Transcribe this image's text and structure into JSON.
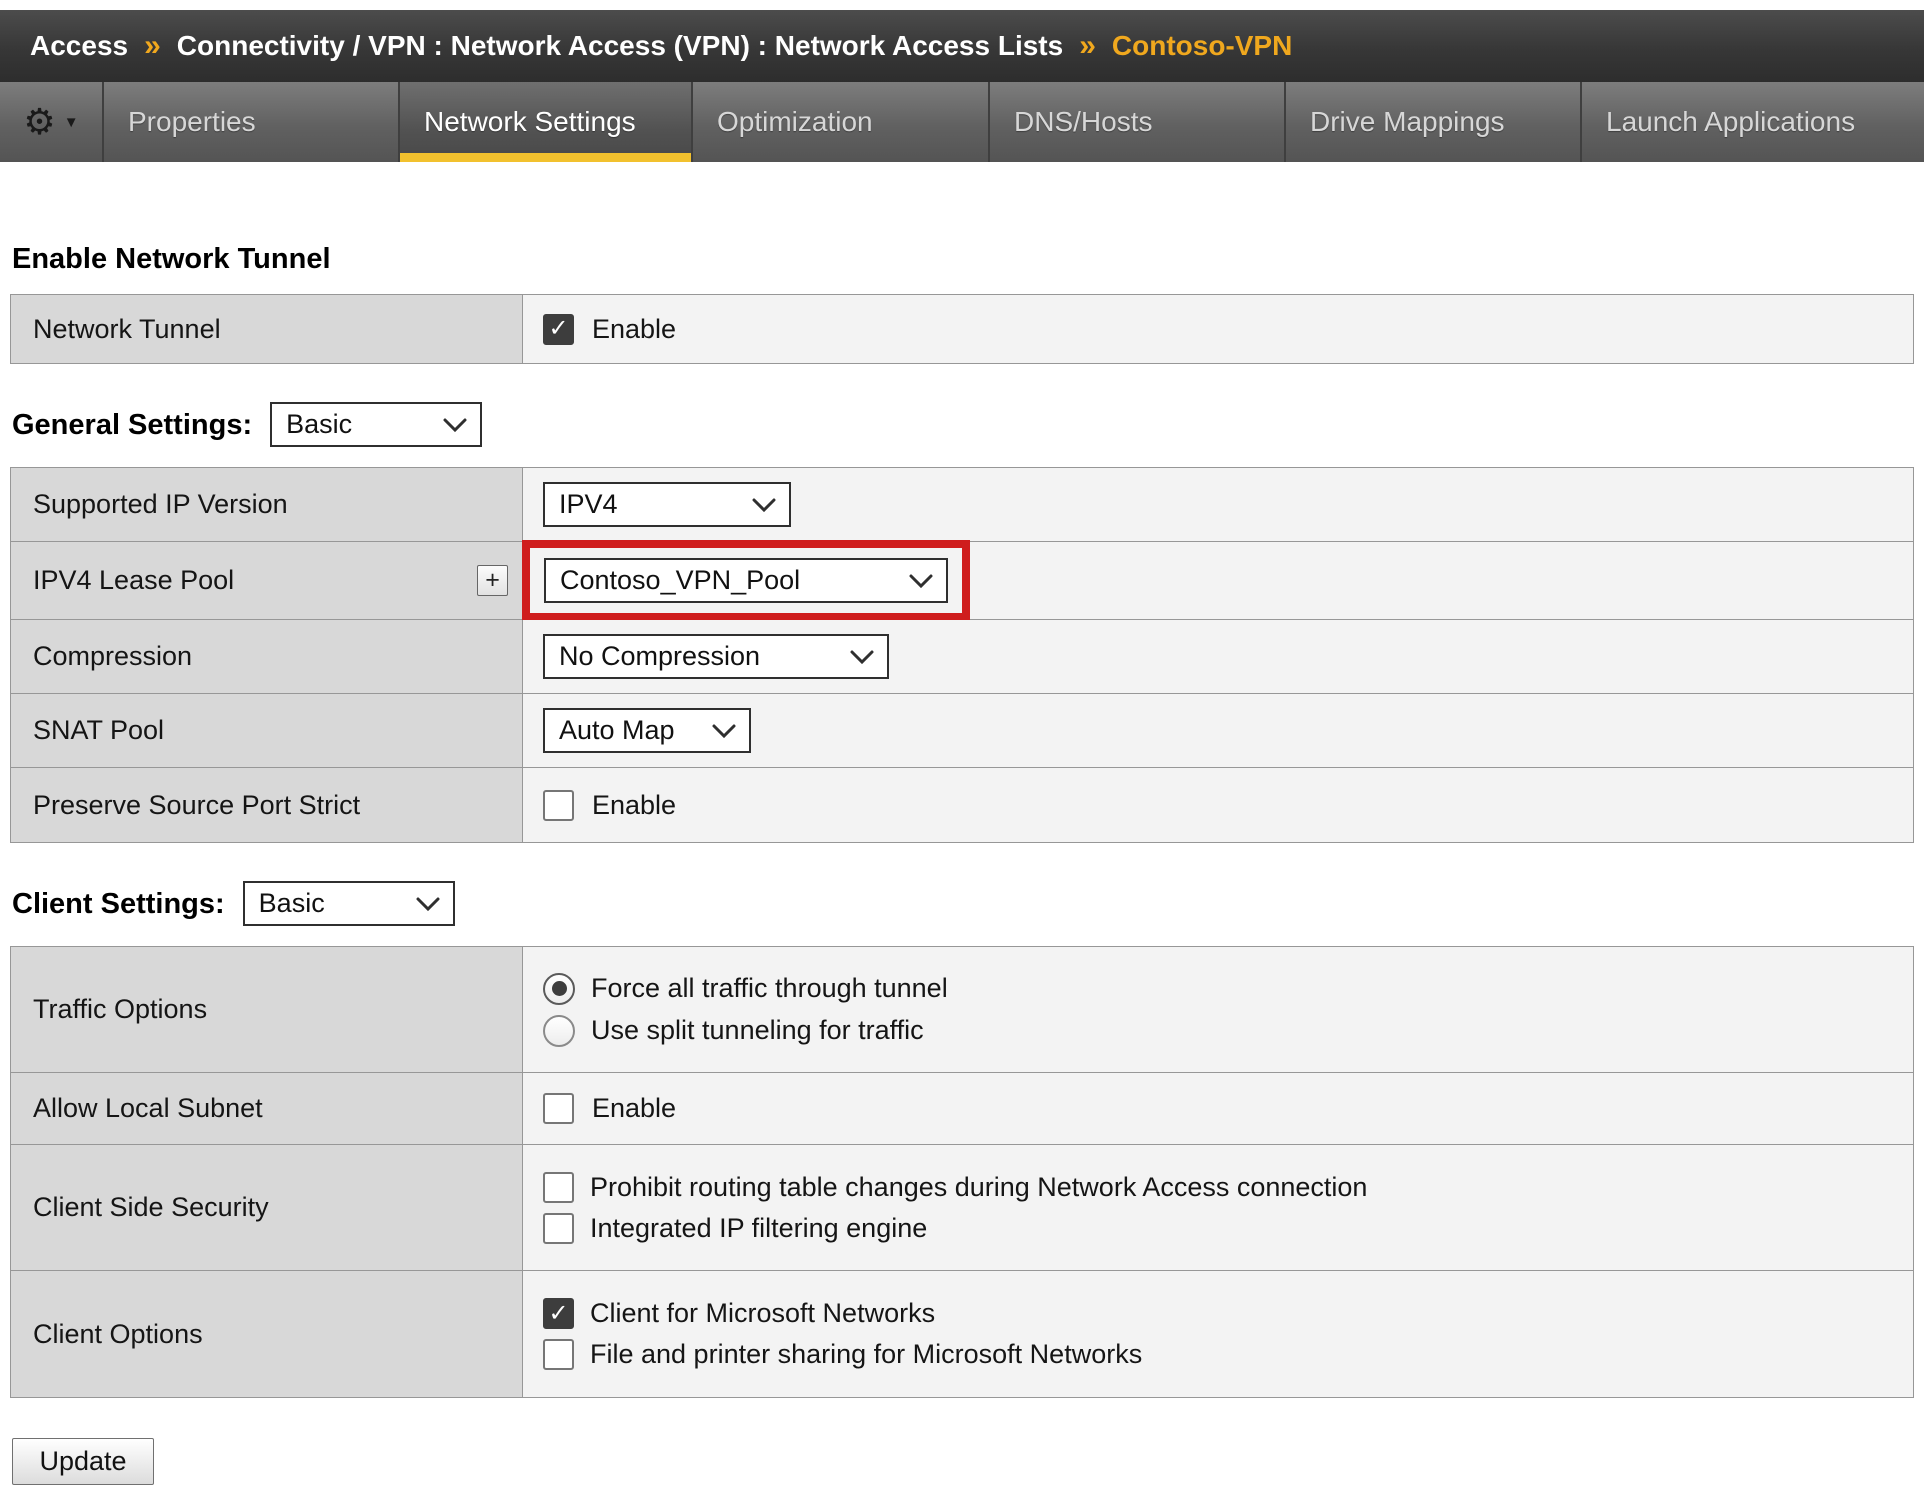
{
  "breadcrumb": {
    "root": "Access",
    "sep1": "»",
    "path": "Connectivity / VPN : Network Access (VPN) : Network Access Lists",
    "sep2": "»",
    "current": "Contoso-VPN"
  },
  "menu": {
    "gear_icon": "⚙",
    "dropdown_arrow": "▼"
  },
  "tabs": [
    {
      "label": "Properties",
      "active": false
    },
    {
      "label": "Network Settings",
      "active": true
    },
    {
      "label": "Optimization",
      "active": false
    },
    {
      "label": "DNS/Hosts",
      "active": false
    },
    {
      "label": "Drive Mappings",
      "active": false
    },
    {
      "label": "Launch Applications",
      "active": false
    }
  ],
  "icons": {
    "check": "✓"
  },
  "tunnel_section": {
    "heading": "Enable Network Tunnel",
    "row_label": "Network Tunnel",
    "enable_label": "Enable",
    "enabled": true
  },
  "general_section": {
    "heading": "General Settings:",
    "mode": "Basic",
    "supported_ip_version": {
      "label": "Supported IP Version",
      "value": "IPV4"
    },
    "ipv4_lease_pool": {
      "label": "IPV4 Lease Pool",
      "add_button": "+",
      "value": "Contoso_VPN_Pool",
      "highlighted": true
    },
    "compression": {
      "label": "Compression",
      "value": "No Compression"
    },
    "snat_pool": {
      "label": "SNAT Pool",
      "value": "Auto Map"
    },
    "preserve_source_port_strict": {
      "label": "Preserve Source Port Strict",
      "enable_label": "Enable",
      "enabled": false
    }
  },
  "client_section": {
    "heading": "Client Settings:",
    "mode": "Basic",
    "traffic_options": {
      "label": "Traffic Options",
      "options": [
        {
          "label": "Force all traffic through tunnel",
          "selected": true
        },
        {
          "label": "Use split tunneling for traffic",
          "selected": false
        }
      ]
    },
    "allow_local_subnet": {
      "label": "Allow Local Subnet",
      "enable_label": "Enable",
      "enabled": false
    },
    "client_side_security": {
      "label": "Client Side Security",
      "options": [
        {
          "label": "Prohibit routing table changes during Network Access connection",
          "checked": false
        },
        {
          "label": "Integrated IP filtering engine",
          "checked": false
        }
      ]
    },
    "client_options": {
      "label": "Client Options",
      "options": [
        {
          "label": "Client for Microsoft Networks",
          "checked": true
        },
        {
          "label": "File and printer sharing for Microsoft Networks",
          "checked": false
        }
      ]
    }
  },
  "footer": {
    "update": "Update"
  },
  "colors": {
    "accent_yellow": "#f2c12e",
    "breadcrumb_gold": "#f0a81e",
    "highlight_red": "#cf1d1d"
  }
}
